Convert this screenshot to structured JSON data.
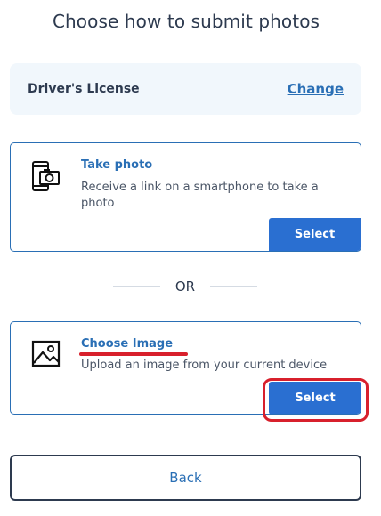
{
  "page": {
    "title": "Choose how to submit photos"
  },
  "document": {
    "label": "Driver's License",
    "change_label": "Change"
  },
  "options": [
    {
      "title": "Take photo",
      "description": "Receive a link on a smartphone to take a photo",
      "select_label": "Select",
      "icon": "smartphone-camera-icon"
    },
    {
      "title": "Choose Image",
      "description": "Upload an image from your current device",
      "select_label": "Select",
      "icon": "image-icon"
    }
  ],
  "divider": {
    "label": "OR"
  },
  "footer": {
    "back_label": "Back"
  },
  "annotations": {
    "highlight_color": "#d8202c"
  },
  "colors": {
    "accent": "#2a6fd1",
    "link": "#2a6fb5",
    "panel_bg": "#f1f7fc"
  }
}
